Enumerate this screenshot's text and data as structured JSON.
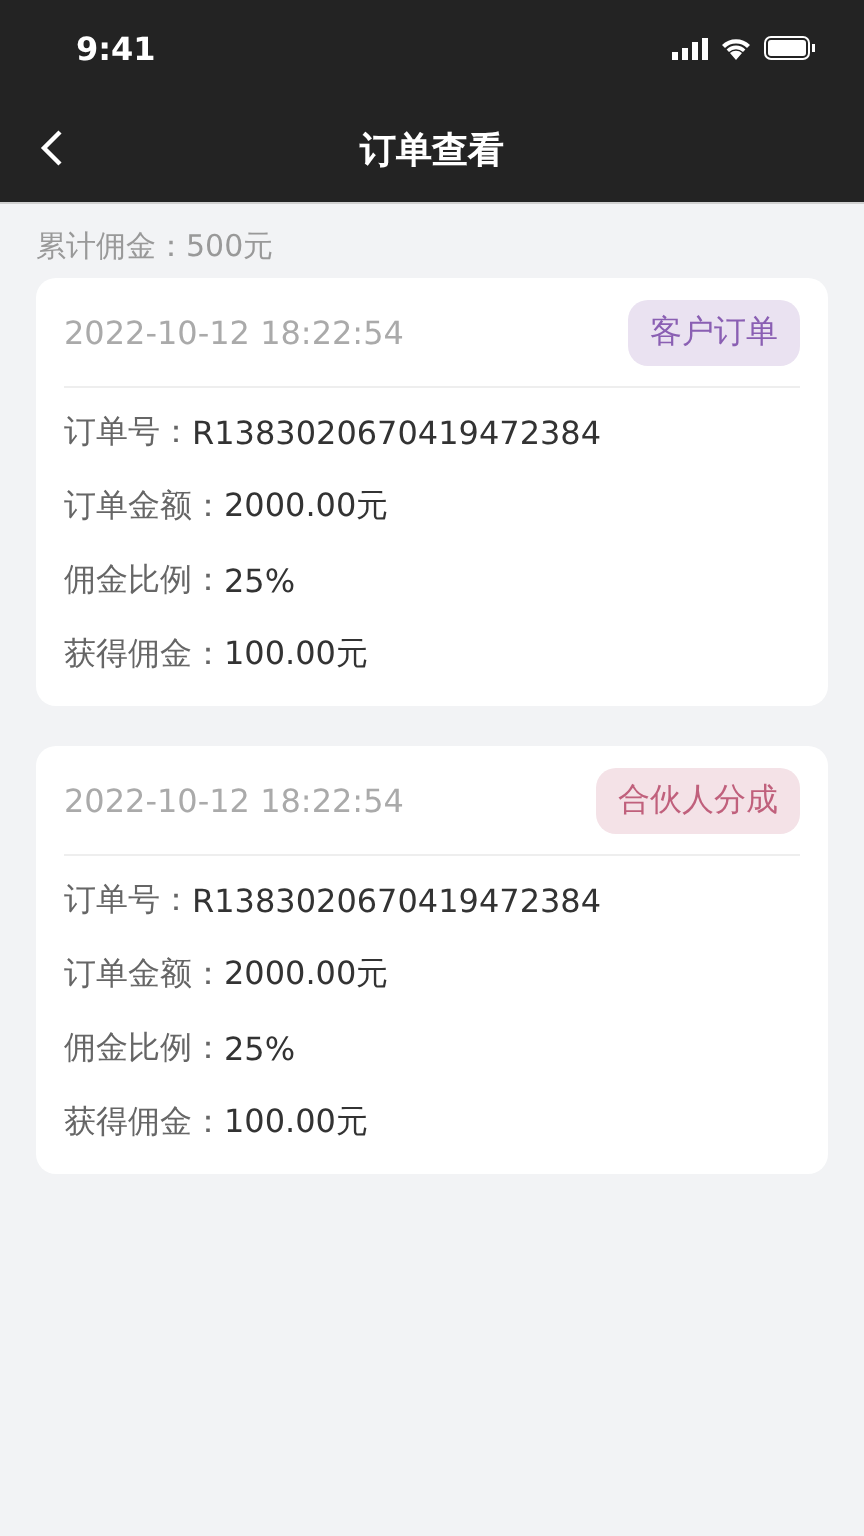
{
  "status_bar": {
    "time": "9:41"
  },
  "nav": {
    "title": "订单查看"
  },
  "summary": {
    "label": "累计佣金：",
    "value": "500元"
  },
  "orders": [
    {
      "time": "2022-10-12 18:22:54",
      "tag": "客户订单",
      "color": "#8a5fb3",
      "fields": [
        {
          "label": "订单号：",
          "value": "R1383020670419472384"
        },
        {
          "label": "订单金额：",
          "value": "2000.00元"
        },
        {
          "label": "佣金比例：",
          "value": "25%"
        },
        {
          "label": "获得佣金：",
          "value": "100.00元"
        }
      ]
    },
    {
      "time": "2022-10-12 18:22:54",
      "tag": "合伙人分成",
      "color": "#c0607c",
      "fields": [
        {
          "label": "订单号：",
          "value": "R1383020670419472384"
        },
        {
          "label": "订单金额：",
          "value": "2000.00元"
        },
        {
          "label": "佣金比例：",
          "value": "25%"
        },
        {
          "label": "获得佣金：",
          "value": "100.00元"
        }
      ]
    }
  ]
}
